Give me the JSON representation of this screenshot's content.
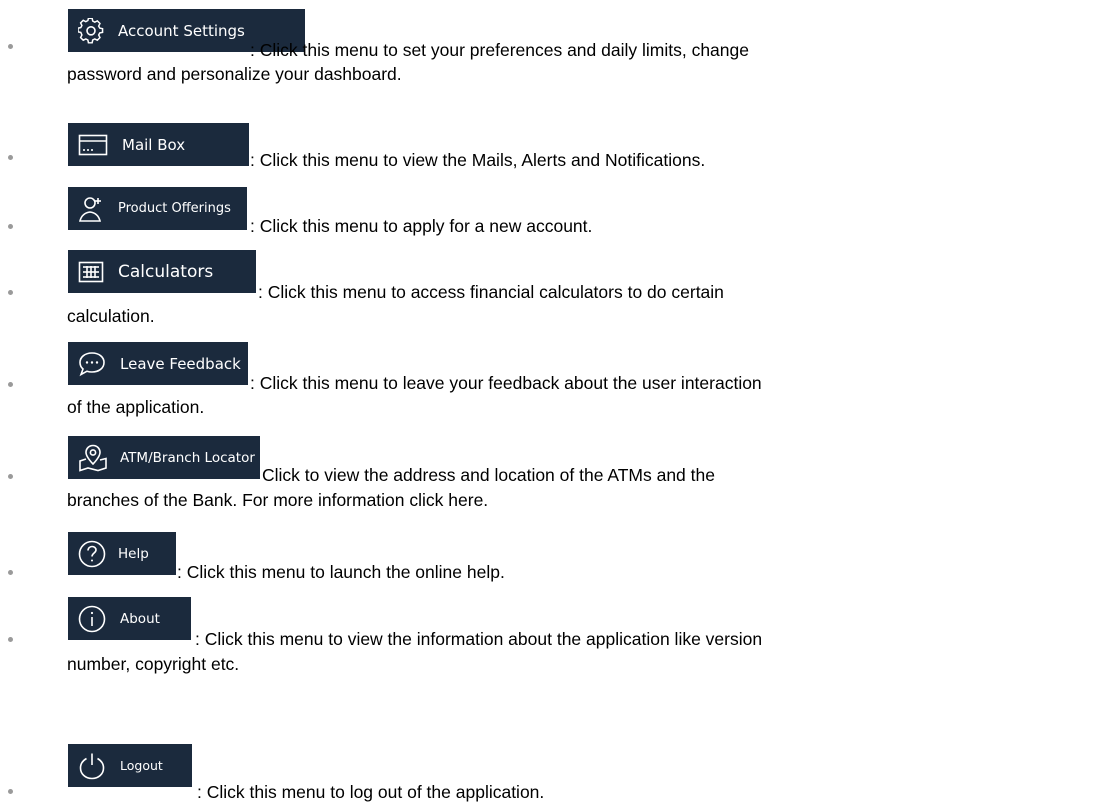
{
  "items": [
    {
      "icon": "gear-icon",
      "label": "Account Settings",
      "description": ": Click this menu to set your preferences and daily limits, change",
      "description_cont": "password and personalize your dashboard."
    },
    {
      "icon": "mailbox-icon",
      "label": "Mail Box",
      "description": ": Click this menu to view the Mails, Alerts and Notifications."
    },
    {
      "icon": "add-user-icon",
      "label": "Product Offerings",
      "description": ": Click this menu to apply for a new account."
    },
    {
      "icon": "calculator-icon",
      "label": "Calculators",
      "description": ": Click this menu to access financial calculators to do certain",
      "description_cont": "calculation."
    },
    {
      "icon": "chat-bubble-icon",
      "label": "Leave Feedback",
      "description": ": Click this menu to leave your feedback about the user interaction",
      "description_cont": "of the application."
    },
    {
      "icon": "location-pin-icon",
      "label": "ATM/Branch Locator",
      "description": "Click to view the address and location of the ATMs and the",
      "description_cont": "branches of the Bank. For more information click here."
    },
    {
      "icon": "help-icon",
      "label": "Help",
      "description": ": Click this menu to launch the online help."
    },
    {
      "icon": "info-icon",
      "label": "About",
      "description": ": Click this menu to view the information about the application like version",
      "description_cont": "number, copyright etc."
    },
    {
      "icon": "power-icon",
      "label": "Logout",
      "description": ": Click this menu to log out of the application."
    }
  ],
  "colors": {
    "button_background": "#1b2a3d",
    "button_text": "#ffffff",
    "bullet": "#9a9a9a",
    "text": "#000000"
  }
}
